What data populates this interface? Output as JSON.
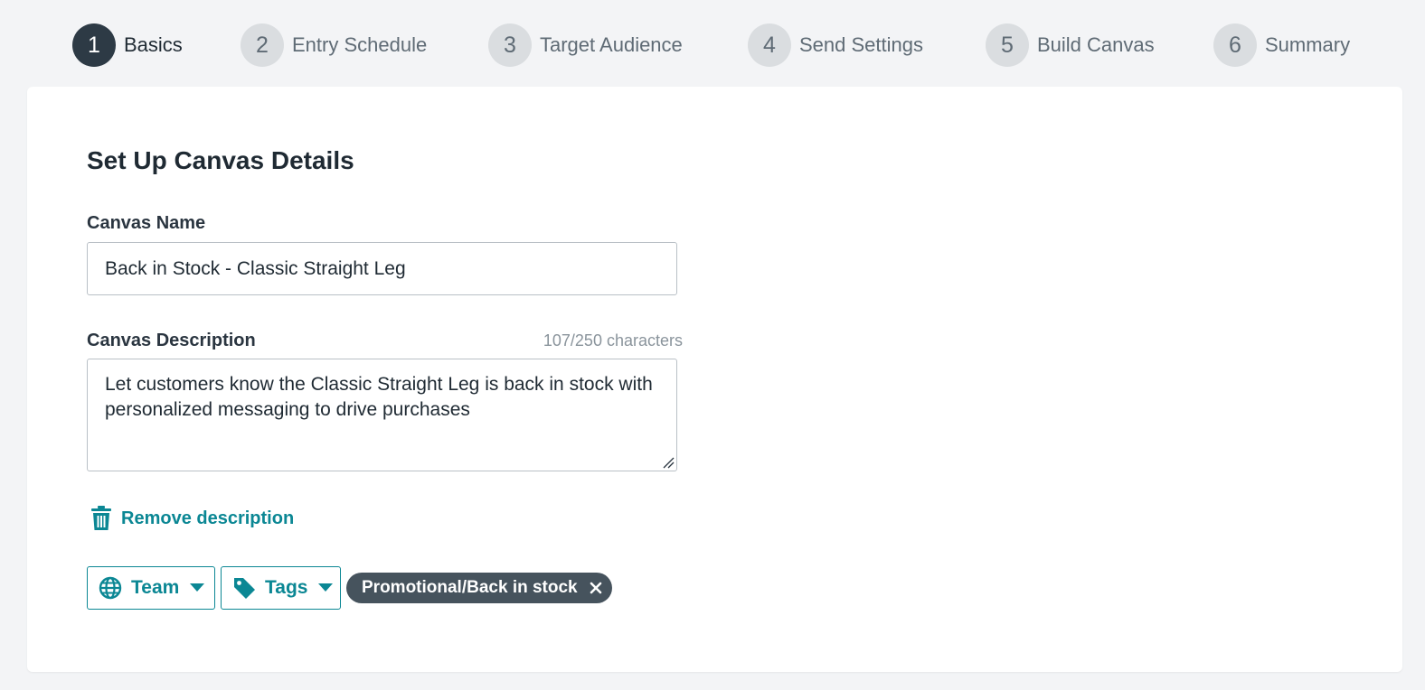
{
  "stepper": {
    "steps": [
      {
        "number": "1",
        "label": "Basics",
        "active": true
      },
      {
        "number": "2",
        "label": "Entry Schedule",
        "active": false
      },
      {
        "number": "3",
        "label": "Target Audience",
        "active": false
      },
      {
        "number": "4",
        "label": "Send Settings",
        "active": false
      },
      {
        "number": "5",
        "label": "Build Canvas",
        "active": false
      },
      {
        "number": "6",
        "label": "Summary",
        "active": false
      }
    ]
  },
  "form": {
    "title": "Set Up Canvas Details",
    "name_label": "Canvas Name",
    "name_value": "Back in Stock - Classic Straight Leg",
    "description_label": "Canvas Description",
    "description_count": "107/250 characters",
    "description_value": "Let customers know the Classic Straight Leg is back in stock with personalized messaging to drive purchases",
    "remove_description_label": "Remove description",
    "team_label": "Team",
    "tags_label": "Tags",
    "tag_chip_label": "Promotional/Back in stock"
  },
  "icons": {
    "remove": "trash-icon",
    "team": "globe-icon",
    "tags": "tag-icon",
    "dropdown": "caret-down-icon",
    "chip_remove": "close-icon"
  },
  "colors": {
    "accent": "#0b8794",
    "active_step": "#2d3a45",
    "inactive_step": "#dadde0",
    "chip_bg": "#46535d",
    "page_bg": "#f3f4f6"
  }
}
